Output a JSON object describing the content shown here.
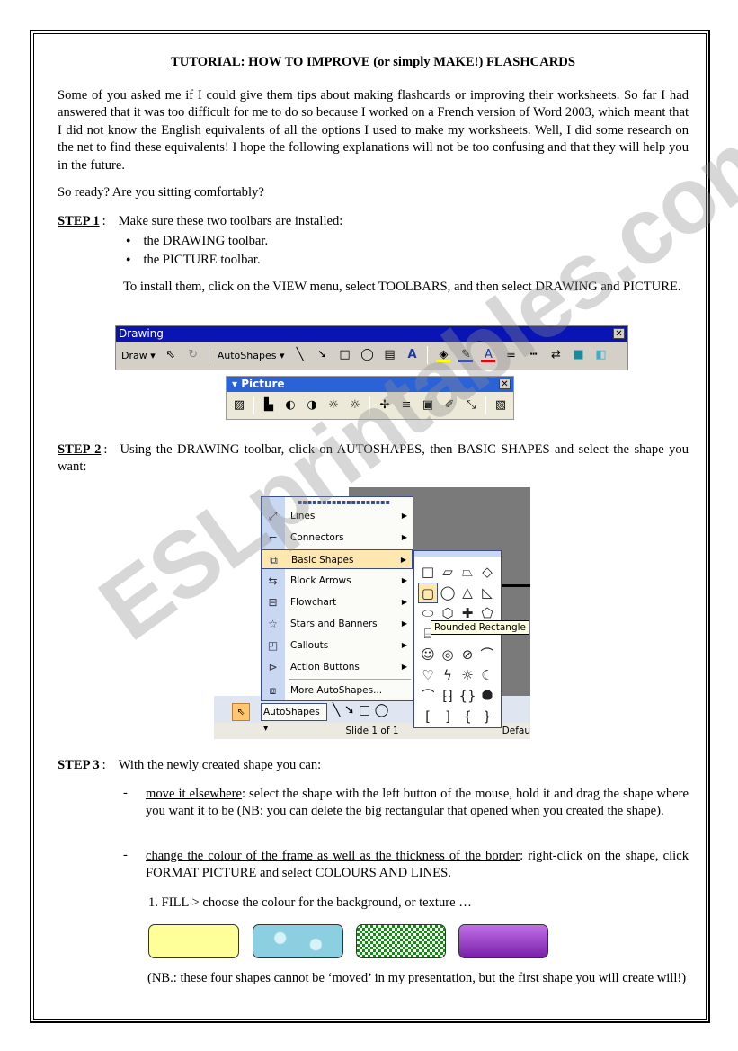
{
  "title": {
    "label": "TUTORIAL",
    "rest": ": HOW TO IMPROVE (or simply MAKE!) FLASHCARDS"
  },
  "intro": "Some of you asked me if I could give them tips about making flashcards or improving their worksheets. So far I had answered that it was too difficult for me to do so because I worked on a French version of Word 2003, which meant that I did not know the English equivalents of all the options I used to make my worksheets. Well, I did some research on the net to find these equivalents! I hope the following explanations will not be too confusing and that they will help you in the future.",
  "ready": "So ready? Are you sitting comfortably?",
  "step1": {
    "label": "STEP 1",
    "text": "Make sure these two toolbars are installed:",
    "bullets": [
      "the DRAWING toolbar.",
      "the PICTURE toolbar."
    ],
    "install": "To install them, click on the VIEW menu, select TOOLBARS, and then select DRAWING and PICTURE."
  },
  "drawing_toolbar": {
    "title": "Drawing",
    "draw": "Draw ▾",
    "autoshapes": "AutoShapes ▾"
  },
  "picture_toolbar": {
    "title": "▾ Picture"
  },
  "step2": {
    "label": "STEP 2",
    "text": "Using the DRAWING toolbar, click on AUTOSHAPES, then BASIC SHAPES and select the shape you want:"
  },
  "autoshapes_menu": {
    "items": [
      "Lines",
      "Connectors",
      "Basic Shapes",
      "Block Arrows",
      "Flowchart",
      "Stars and Banners",
      "Callouts",
      "Action Buttons",
      "More AutoShapes..."
    ],
    "tooltip": "Rounded Rectangle",
    "autoshapes_button": "AutoShapes ▾",
    "status": "Slide 1 of 1",
    "status_right": "Defau"
  },
  "step3": {
    "label": "STEP 3",
    "text": "With the newly created shape you can:",
    "items": [
      {
        "lead": "move it elsewhere",
        "text": ": select the shape with the left button of the mouse, hold it and drag the shape where you want it to be (NB: you can delete the big rectangular that opened when you created the shape)."
      },
      {
        "lead": "change the colour of the frame as well as the thickness of the border",
        "text": ": right-click on the shape, click FORMAT PICTURE and select COLOURS AND LINES."
      }
    ],
    "fill": "1.  FILL > choose the colour for the background, or texture …",
    "note": "(NB.: these four shapes cannot be ‘moved’ in my presentation, but the first shape you will create will!)"
  },
  "fill_colors": [
    "#ffff99",
    "#9fd8e6",
    "#009900",
    "#9933cc"
  ],
  "watermark": "ESLprintables.com"
}
